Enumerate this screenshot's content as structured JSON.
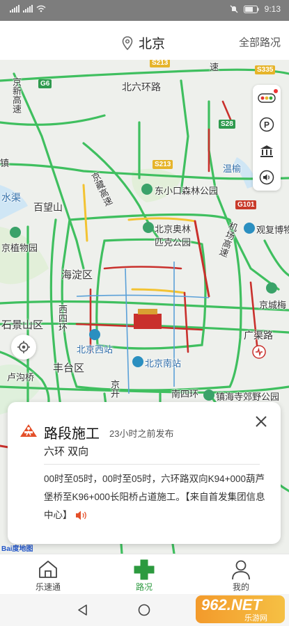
{
  "status_bar": {
    "left_text": "4G 4G",
    "time": "9:13"
  },
  "header": {
    "city": "北京",
    "all_roads": "全部路况"
  },
  "map": {
    "labels": {
      "north_ring": "北六环路",
      "jingxin": "京新高速",
      "jingzang": "京藏高速",
      "dongxiao": "东小口森林公园",
      "baiwang": "百望山",
      "beijing_olympic": "北京奥林",
      "olympic2": "匹克公园",
      "haidian": "海淀区",
      "jzw": "京植物园",
      "xisihuan": "西四环",
      "shijingshan": "石景山区",
      "xizhan": "北京西站",
      "nanzhan": "北京南站",
      "fengtai": "丰台区",
      "lugou": "卢沟桥",
      "nansihuan": "南四环",
      "guangqu": "广渠路",
      "jingcheng": "京城梅",
      "airport": "机场高速",
      "guanfu": "观复博物",
      "wenyu": "温榆",
      "shui": "水渠",
      "zhen": "镇",
      "jingkai": "京开",
      "zhenhai": "镇海寺郊野公园",
      "su": "速"
    },
    "shields": [
      "G6",
      "S213",
      "S335",
      "S28",
      "S213",
      "G101"
    ]
  },
  "card": {
    "title": "路段施工",
    "time": "23小时之前发布",
    "road": "六环 双向",
    "body": "00时至05时，00时至05时，六环路双向K94+000葫芦堡桥至K96+000长阳桥占道施工。【来自首发集团信息中心】"
  },
  "bottom_nav": {
    "items": [
      {
        "label": "乐速通"
      },
      {
        "label": "路况"
      },
      {
        "label": "我的"
      }
    ]
  },
  "watermark": {
    "text": "962.NET",
    "sub": "乐游网"
  },
  "baidu": "Bai度地图",
  "colors": {
    "green_road": "#3fbf5f",
    "red_road": "#c9302c",
    "yellow_road": "#f3c332",
    "accent": "#2c9a3f",
    "construction": "#e4502a"
  }
}
